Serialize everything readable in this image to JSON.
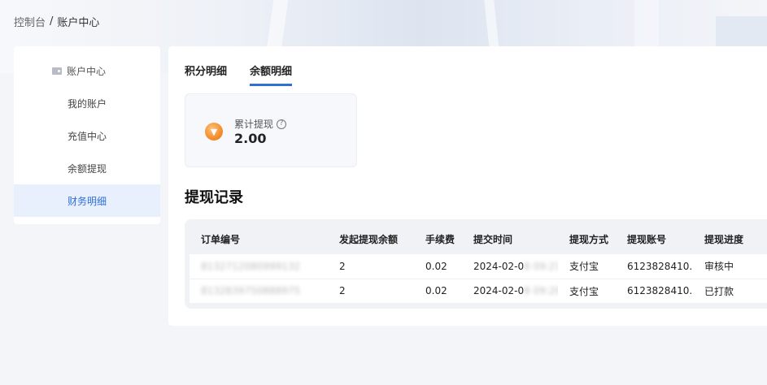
{
  "breadcrumb": {
    "root": "控制台",
    "separator": "/",
    "current": "账户中心"
  },
  "sidebar": {
    "header": "账户中心",
    "items": [
      {
        "label": "我的账户"
      },
      {
        "label": "充值中心"
      },
      {
        "label": "余额提现"
      },
      {
        "label": "财务明细"
      }
    ]
  },
  "tabs": [
    {
      "label": "积分明细"
    },
    {
      "label": "余额明细"
    }
  ],
  "stat": {
    "label": "累计提现",
    "value": "2.00",
    "help": "?"
  },
  "section_title": "提现记录",
  "table": {
    "headers": [
      "订单编号",
      "发起提现余额",
      "手续费",
      "提交时间",
      "提现方式",
      "提现账号",
      "提现进度"
    ],
    "rows": [
      {
        "order": "8132712080999132",
        "amount": "2",
        "fee": "0.02",
        "time_visible": "2024-02-0",
        "time_blurred": "8 09:21:0",
        "method": "支付宝",
        "account": "6123828410...",
        "status": "审核中"
      },
      {
        "order": "8132839750888975",
        "amount": "2",
        "fee": "0.02",
        "time_visible": "2024-02-0",
        "time_blurred": "8 09:20:1",
        "method": "支付宝",
        "account": "6123828410...",
        "status": "已打款"
      }
    ]
  },
  "colors": {
    "accent": "#2f6fd6",
    "active_bg": "#e8f0fe",
    "icon_orange": "#f59132"
  }
}
